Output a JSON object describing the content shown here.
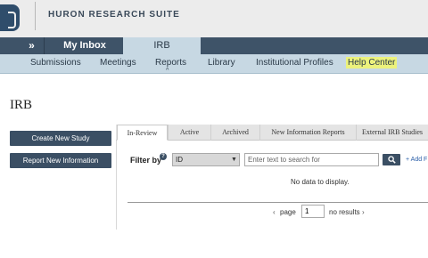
{
  "header": {
    "suite_name": "HURON RESEARCH SUITE"
  },
  "topnav": {
    "expand_glyph": "»",
    "inbox_label": "My Inbox",
    "irb_label": "IRB"
  },
  "subnav": {
    "items": [
      "Submissions",
      "Meetings",
      "Reports",
      "Library",
      "Institutional Profiles",
      "Help Center"
    ],
    "highlighted": "Help Center",
    "highlight_color": "#ecf27c"
  },
  "page": {
    "title": "IRB"
  },
  "actions": {
    "create": "Create New Study",
    "report": "Report New Information"
  },
  "tabs": [
    "In-Review",
    "Active",
    "Archived",
    "New Information Reports",
    "External IRB Studies"
  ],
  "active_tab": "In-Review",
  "filter": {
    "label": "Filter by",
    "selected": "ID",
    "placeholder": "Text to search for",
    "placeholder_display": "Enter text to search for",
    "add_link": "+ Add F"
  },
  "table": {
    "empty_message": "No data to display."
  },
  "pager": {
    "prev": "‹",
    "label": "page",
    "page": "1",
    "results": "no results",
    "next": "›"
  },
  "colors": {
    "nav_dark": "#3e5368",
    "nav_light": "#c7d8e3",
    "button": "#3b4f64"
  }
}
